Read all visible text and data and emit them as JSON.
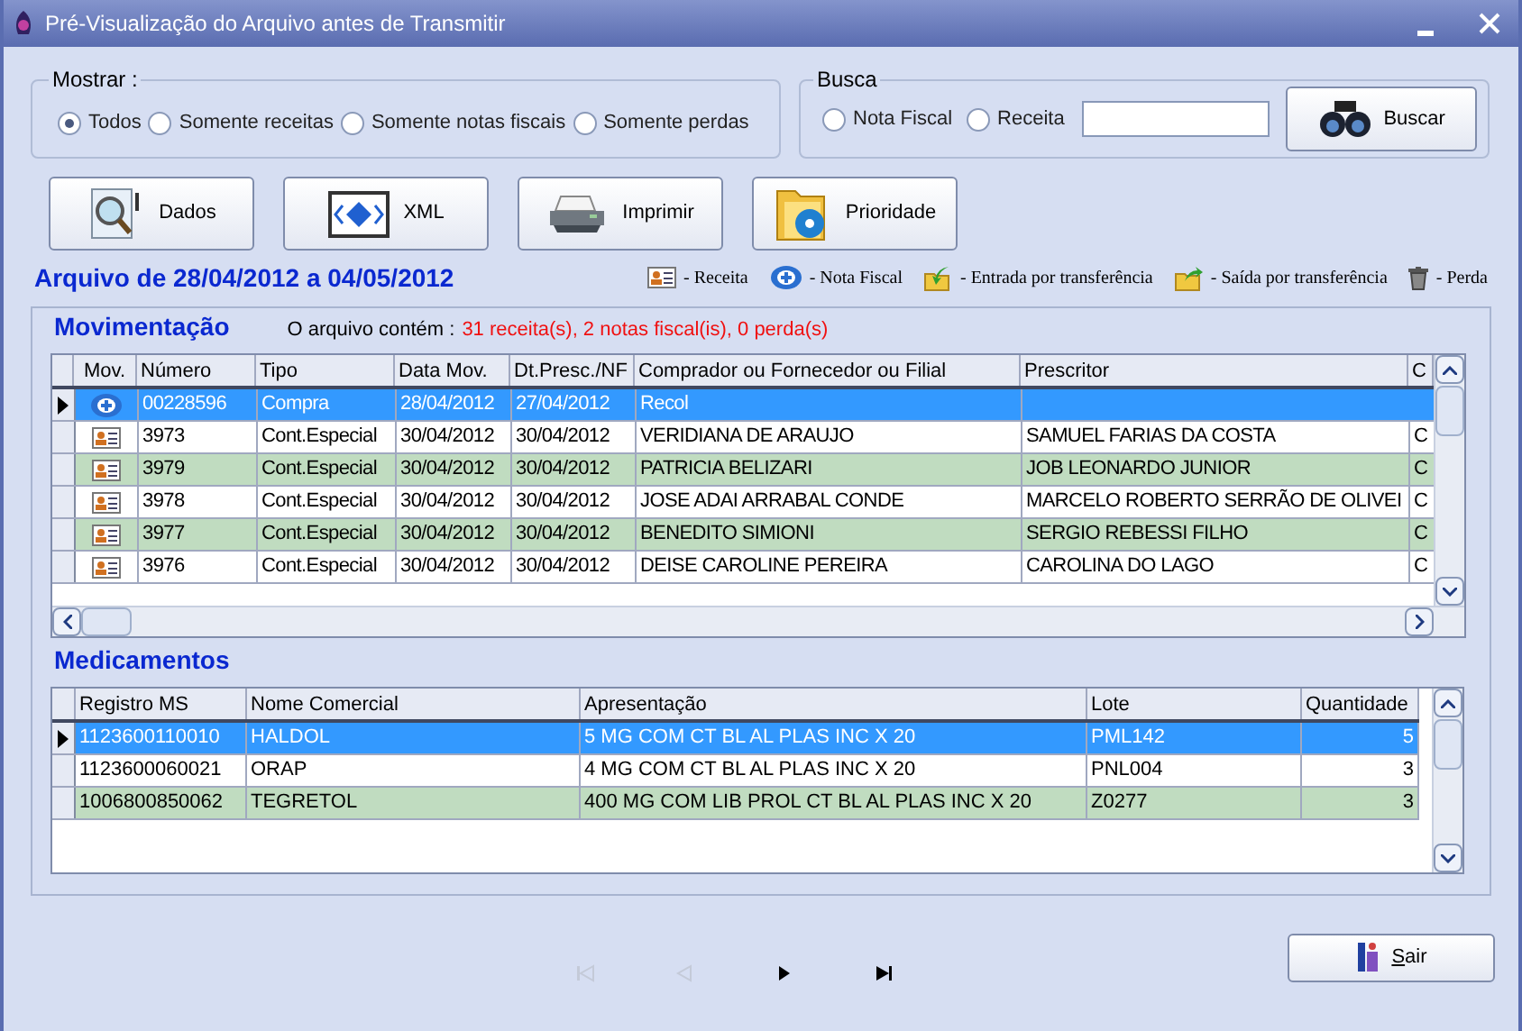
{
  "window": {
    "title": "Pré-Visualização do Arquivo antes de Transmitir"
  },
  "mostrar": {
    "label": "Mostrar :",
    "options": [
      {
        "label": "Todos",
        "selected": true
      },
      {
        "label": "Somente receitas",
        "selected": false
      },
      {
        "label": "Somente notas fiscais",
        "selected": false
      },
      {
        "label": "Somente perdas",
        "selected": false
      }
    ]
  },
  "busca": {
    "label": "Busca",
    "options": [
      {
        "label": "Nota Fiscal",
        "selected": false
      },
      {
        "label": "Receita",
        "selected": false
      }
    ],
    "button": "Buscar"
  },
  "toolbar": [
    {
      "kind": "dados",
      "label": "Dados"
    },
    {
      "kind": "xml",
      "label": "XML"
    },
    {
      "kind": "imprimir",
      "label": "Imprimir"
    },
    {
      "kind": "prioridade",
      "label": "Prioridade"
    }
  ],
  "period": "Arquivo de 28/04/2012 a 04/05/2012",
  "legend": [
    {
      "kind": "receita",
      "label": "- Receita"
    },
    {
      "kind": "nota",
      "label": "- Nota Fiscal"
    },
    {
      "kind": "entrada",
      "label": "- Entrada por transferência"
    },
    {
      "kind": "saida",
      "label": "- Saída por transferência"
    },
    {
      "kind": "perda",
      "label": "- Perda"
    }
  ],
  "movimentacao": {
    "title": "Movimentação",
    "summary_label": "O arquivo contém :",
    "summary": "31 receita(s), 2 notas fiscal(is), 0 perda(s)",
    "icon_column": "Mov.",
    "columns": [
      "Número",
      "Tipo",
      "Data Mov.",
      "Dt.Presc./NF",
      "Comprador ou Fornecedor ou Filial",
      "Prescritor",
      "C"
    ],
    "rows": [
      {
        "kind": "nota",
        "selected": true,
        "cells": [
          "00228596",
          "Compra",
          "28/04/2012",
          "27/04/2012",
          "Recol"
        ]
      },
      {
        "kind": "receita",
        "selected": false,
        "cells": [
          "3973",
          "Cont.Especial",
          "30/04/2012",
          "30/04/2012",
          "VERIDIANA DE ARAUJO",
          "SAMUEL FARIAS DA COSTA",
          "C"
        ]
      },
      {
        "kind": "receita",
        "selected": false,
        "cells": [
          "3979",
          "Cont.Especial",
          "30/04/2012",
          "30/04/2012",
          "PATRICIA BELIZARI",
          "JOB LEONARDO JUNIOR",
          "C"
        ]
      },
      {
        "kind": "receita",
        "selected": false,
        "cells": [
          "3978",
          "Cont.Especial",
          "30/04/2012",
          "30/04/2012",
          "JOSE ADAI ARRABAL CONDE",
          "MARCELO ROBERTO SERRÃO DE OLIVEI",
          "C"
        ]
      },
      {
        "kind": "receita",
        "selected": false,
        "cells": [
          "3977",
          "Cont.Especial",
          "30/04/2012",
          "30/04/2012",
          "BENEDITO SIMIONI",
          "SERGIO REBESSI FILHO",
          "C"
        ]
      },
      {
        "kind": "receita",
        "selected": false,
        "cells": [
          "3976",
          "Cont.Especial",
          "30/04/2012",
          "30/04/2012",
          "DEISE CAROLINE PEREIRA",
          "CAROLINA DO LAGO",
          "C"
        ]
      }
    ]
  },
  "medicamentos": {
    "title": "Medicamentos",
    "columns": [
      "Registro MS",
      "Nome Comercial",
      "Apresentação",
      "Lote",
      "Quantidade"
    ],
    "rows": [
      {
        "selected": true,
        "cells": [
          "1123600110010",
          "HALDOL",
          "5 MG COM CT BL AL PLAS INC X 20",
          "PML142",
          "5"
        ]
      },
      {
        "selected": false,
        "cells": [
          "1123600060021",
          "ORAP",
          "4 MG COM CT BL AL PLAS INC X 20",
          "PNL004",
          "3"
        ]
      },
      {
        "selected": false,
        "cells": [
          "1006800850062",
          "TEGRETOL",
          "400 MG COM LIB PROL CT BL AL PLAS INC X 20",
          "Z0277",
          "3"
        ]
      }
    ]
  },
  "navigation": [
    {
      "kind": "first",
      "disabled": true
    },
    {
      "kind": "prev",
      "disabled": true
    },
    {
      "kind": "next",
      "disabled": false
    },
    {
      "kind": "last",
      "disabled": false
    }
  ],
  "exit_button": "Sair"
}
